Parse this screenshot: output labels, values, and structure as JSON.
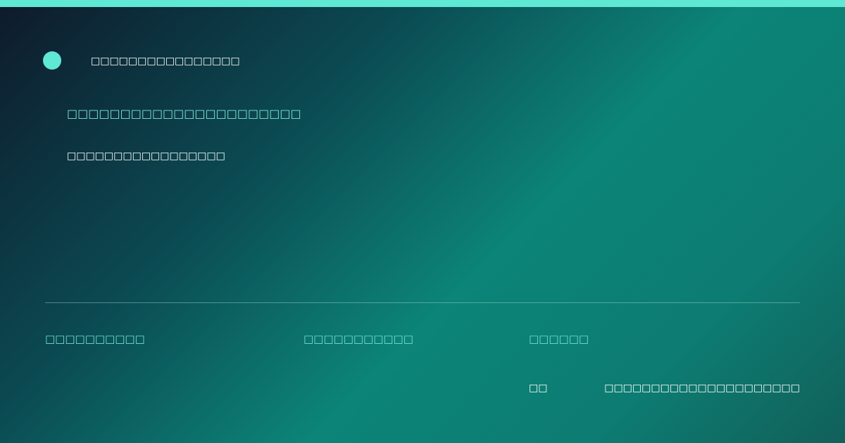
{
  "colors": {
    "accent": "#5fe8d4",
    "accent_text": "#7fe6d6",
    "text": "#ffffff",
    "bg_dark": "#0e1a2b",
    "bg_teal": "#0c8478"
  },
  "header": {
    "logo_icon": "circle-logo",
    "brand": "□□□□□□□□□□□□□□□□"
  },
  "hero": {
    "headline": "□□□□□□□□□□□□□□□□□□□□□□",
    "subline": "□□□□□□□□□□□□□□□□□"
  },
  "footer": {
    "columns": [
      {
        "label": "□□□□□□□□□□"
      },
      {
        "label": "□□□□□□□□□□□"
      },
      {
        "label": "□□□□□□"
      }
    ],
    "row": {
      "key": "□□",
      "value": "□□□□□□□□□□□□□□□□□□□□□"
    }
  }
}
